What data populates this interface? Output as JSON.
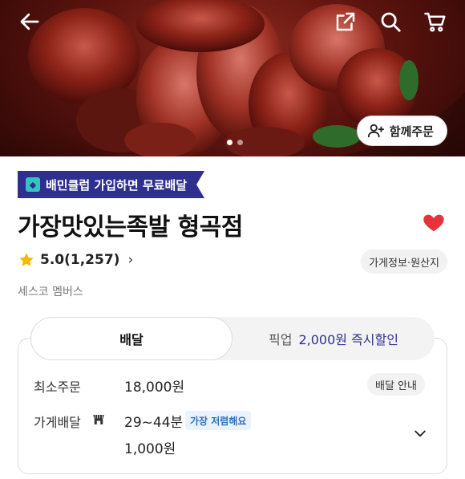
{
  "header": {
    "icons": [
      "back-arrow-icon",
      "share-icon",
      "search-icon",
      "cart-icon"
    ],
    "group_order_label": "함께주문",
    "carousel": {
      "pages": 2,
      "active": 1
    }
  },
  "store": {
    "club_banner": "배민클럽 가입하면 무료배달",
    "name": "가장맛있는족발 형곡점",
    "rating": "5.0(1,257)",
    "info_button": "가게정보·원산지",
    "membership": "세스코 멤버스",
    "heart_color": "#e8323b"
  },
  "order_tabs": {
    "delivery": "배달",
    "pickup": "픽업",
    "pickup_promo": "2,000원 즉시할인"
  },
  "delivery_info": {
    "min_order_label": "최소주문",
    "min_order_value": "18,000원",
    "guide_button": "배달 안내",
    "store_delivery_label": "가게배달",
    "time": "29~44분",
    "cheap_badge": "가장 저렴해요",
    "fee": "1,000원"
  },
  "colors": {
    "brand_navy": "#2e2f8f",
    "badge_blue": "#2f6fc4",
    "star": "#f5b800"
  }
}
